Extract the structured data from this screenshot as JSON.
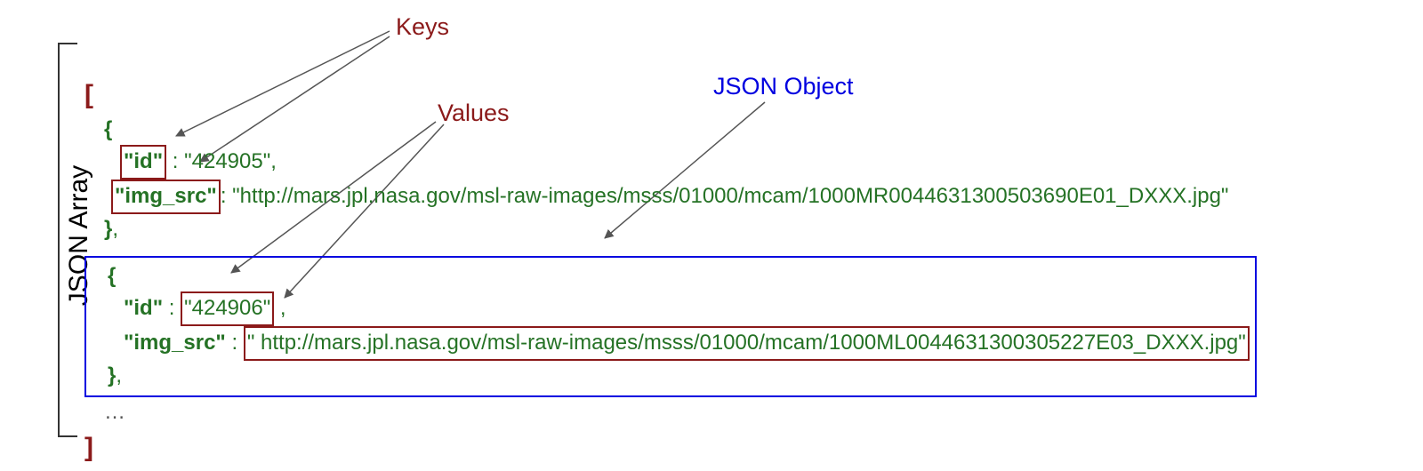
{
  "side_label": "JSON Array",
  "labels": {
    "keys": "Keys",
    "values": "Values",
    "object": "JSON Object"
  },
  "code": {
    "open": "[",
    "close": "]",
    "obj1": {
      "key1": "\"id\"",
      "val1": "\"424905\"",
      "key2": "\"img_src\"",
      "val2": "\"http://mars.jpl.nasa.gov/msl-raw-images/msss/01000/mcam/1000MR0044631300503690E01_DXXX.jpg\""
    },
    "obj2": {
      "key1": "\"id\"",
      "val1": "\"424906\"",
      "key2": "\"img_src\"",
      "val2_space": "\" http://mars.jpl.nasa.gov/msl-raw-images/msss/01000/mcam/1000ML0044631300305227E03_DXXX.jpg\""
    },
    "ellipsis": "…"
  }
}
